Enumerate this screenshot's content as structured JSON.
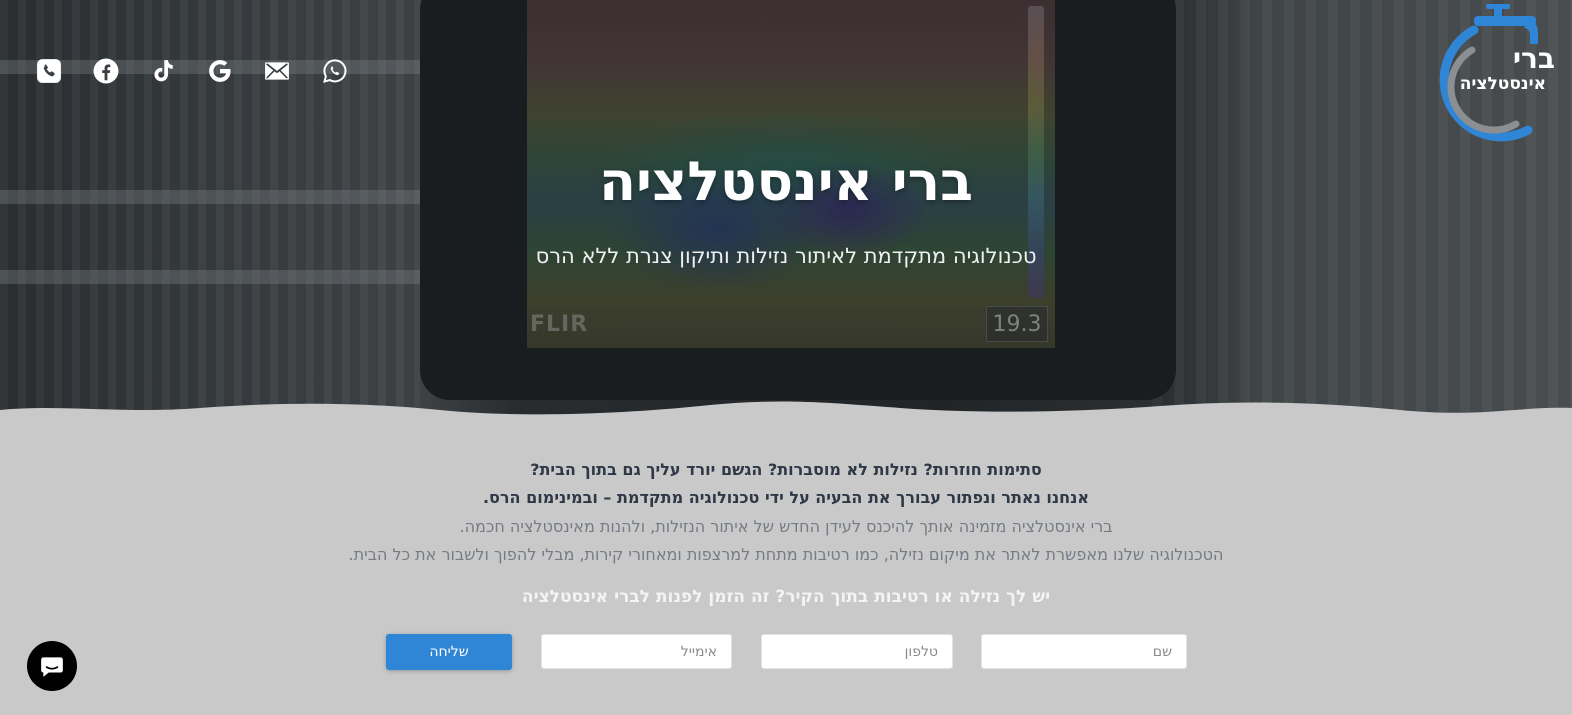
{
  "header": {
    "social_icons": [
      "phone-icon",
      "facebook-icon",
      "tiktok-icon",
      "google-icon",
      "email-icon",
      "whatsapp-icon"
    ],
    "logo": {
      "title": "ברי",
      "subtitle": "אינסטלציה",
      "icon": "faucet-icon",
      "accent_color": "#2f86d6"
    }
  },
  "hero": {
    "title": "ברי אינסטלציה",
    "subtitle": "טכנולוגיה מתקדמת לאיתור נזילות ותיקון צנרת ללא הרס",
    "camera_brand": "FLIR",
    "camera_temp": "19.3"
  },
  "about": {
    "line1": "סתימות חוזרות? נזילות לא מוסברות? הגשם יורד עליך גם בתוך הבית?",
    "line2": "אנחנו נאתר ונפתור עבורך את הבעיה על ידי טכנולוגיה מתקדמת – ובמינימום הרס.",
    "line3": "ברי אינסטלציה מזמינה אותך להיכנס לעידן החדש של איתור הנזילות, ולהנות מאינסטלציה חכמה.",
    "line4": "הטכנולוגיה שלנו מאפשרת לאתר את מיקום נזילה, כמו רטיבות מתחת למרצפות ומאחורי קירות, מבלי להפוך ולשבור את כל הבית."
  },
  "cta": {
    "text": "יש לך נזילה או רטיבות בתוך הקיר? זה הזמן לפנות לברי אינסטלציה"
  },
  "form": {
    "name_placeholder": "שם",
    "phone_placeholder": "טלפון",
    "email_placeholder": "אימייל",
    "submit_label": "שליחה",
    "button_color": "#2f86d6"
  },
  "chat": {
    "icon": "chat-bubble-icon"
  }
}
